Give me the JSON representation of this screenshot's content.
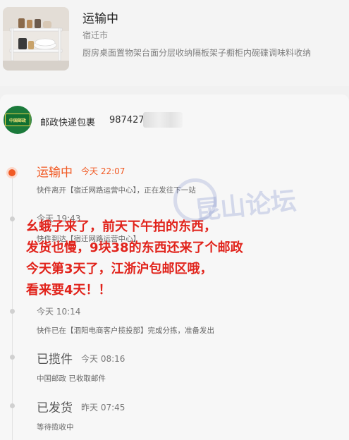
{
  "product": {
    "status": "运输中",
    "city": "宿迁市",
    "name": "厨房桌面置物架台面分层收纳隔板架子橱柜内碗碟调味料收纳"
  },
  "carrier": {
    "logo_text": "中国邮政",
    "name": "邮政快递包裹",
    "tracking_number": "987427"
  },
  "events": [
    {
      "status": "运输中",
      "time": "今天 22:07",
      "desc": "快件离开【宿迁网路运营中心】，正在发往下一站"
    },
    {
      "status": "",
      "time": "今天 19:43",
      "desc": "快件到达【宿迁网路运营中心】"
    },
    {
      "status": "",
      "time": "今天 10:14",
      "desc": "快件已在【泗阳电商客户揽投部】完成分拣，准备发出"
    },
    {
      "status": "已揽件",
      "time": "今天 08:16",
      "desc": "中国邮政 已收取邮件"
    },
    {
      "status": "已发货",
      "time": "昨天 07:45",
      "desc": "等待揽收中"
    }
  ],
  "watermark": "昆山论坛",
  "overlay_lines": [
    "幺蛾子来了，前天下午拍的东西，",
    "发货也慢，9块38的东西还来了个邮政",
    "今天第3天了，江浙沪包邮区哦，",
    "看来要4天！！"
  ],
  "colors": {
    "accent": "#f15a24",
    "overlay_red": "#e1231b",
    "carrier_green": "#1b7a3b"
  }
}
